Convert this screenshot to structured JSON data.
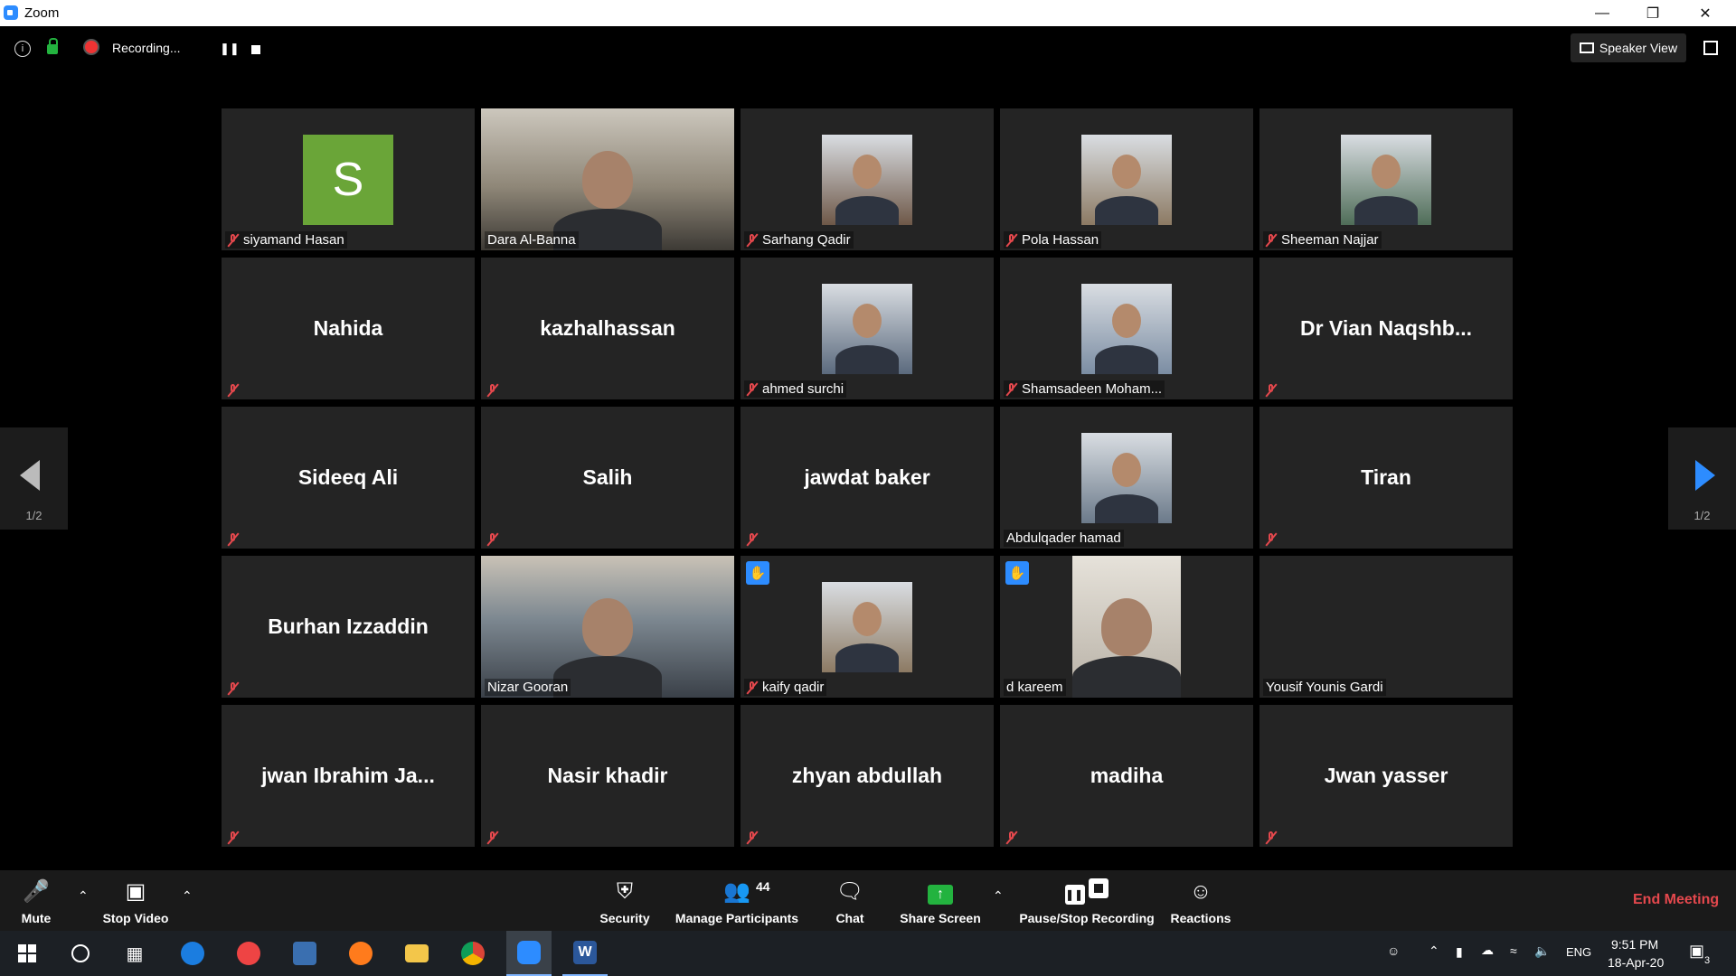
{
  "window": {
    "title": "Zoom"
  },
  "topbar": {
    "recording_label": "Recording...",
    "speaker_view_label": "Speaker View"
  },
  "participants": [
    {
      "name": "siyamand Hasan",
      "display": "",
      "muted": true,
      "avatar_letter": "S",
      "avatar_color": "#6aa538"
    },
    {
      "name": "Dara Al-Banna",
      "display": "",
      "muted": false,
      "video": true
    },
    {
      "name": "Sarhang Qadir",
      "display": "",
      "muted": true,
      "photo": true
    },
    {
      "name": "Pola Hassan",
      "display": "",
      "muted": true,
      "photo": true
    },
    {
      "name": "Sheeman Najjar",
      "display": "",
      "muted": true,
      "photo": true
    },
    {
      "name": "",
      "display": "Nahida",
      "muted": true
    },
    {
      "name": "",
      "display": "kazhalhassan",
      "muted": true
    },
    {
      "name": "ahmed surchi",
      "display": "",
      "muted": true,
      "photo": true
    },
    {
      "name": "Shamsadeen Moham...",
      "display": "",
      "muted": true,
      "photo": true
    },
    {
      "name": "",
      "display": "Dr Vian Naqshb...",
      "muted": true
    },
    {
      "name": "",
      "display": "Sideeq Ali",
      "muted": true
    },
    {
      "name": "",
      "display": "Salih",
      "muted": true
    },
    {
      "name": "",
      "display": "jawdat baker",
      "muted": true
    },
    {
      "name": "Abdulqader hamad",
      "display": "",
      "muted": false,
      "photo": true
    },
    {
      "name": "",
      "display": "Tiran",
      "muted": true
    },
    {
      "name": "",
      "display": "Burhan Izzaddin",
      "muted": true
    },
    {
      "name": "Nizar Gooran",
      "display": "",
      "muted": false,
      "video": true,
      "active": true
    },
    {
      "name": "kaify qadir",
      "display": "",
      "muted": true,
      "photo": true,
      "hand": true
    },
    {
      "name": "d kareem",
      "display": "",
      "muted": false,
      "video": true,
      "hand": true
    },
    {
      "name": "Yousif Younis Gardi",
      "display": "",
      "muted": false
    },
    {
      "name": "",
      "display": "jwan  Ibrahim Ja...",
      "muted": true
    },
    {
      "name": "",
      "display": "Nasir khadir",
      "muted": true
    },
    {
      "name": "",
      "display": "zhyan abdullah",
      "muted": true
    },
    {
      "name": "",
      "display": "madiha",
      "muted": true
    },
    {
      "name": "",
      "display": "Jwan yasser",
      "muted": true
    }
  ],
  "pager": {
    "left_label": "1/2",
    "right_label": "1/2"
  },
  "toolbar": {
    "mute": "Mute",
    "stop_video": "Stop Video",
    "security": "Security",
    "manage_participants": "Manage Participants",
    "participant_count": "44",
    "chat": "Chat",
    "share_screen": "Share Screen",
    "pause_stop_recording": "Pause/Stop Recording",
    "reactions": "Reactions",
    "end_meeting": "End Meeting"
  },
  "taskbar": {
    "language": "ENG",
    "time": "9:51 PM",
    "date": "18-Apr-20",
    "notification_count": "3"
  },
  "colors": {
    "accent": "#2d8cff",
    "end": "#e5484d",
    "active_border": "#e9f28d",
    "share_green": "#23b33f"
  }
}
